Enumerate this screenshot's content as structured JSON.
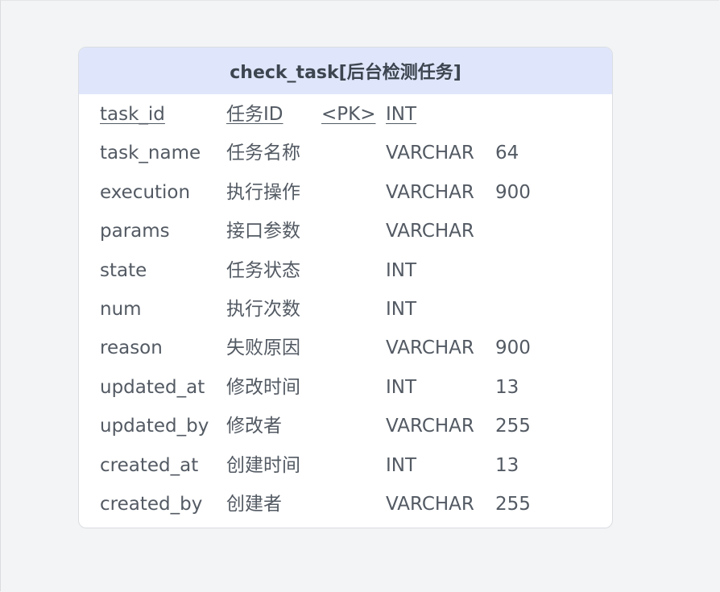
{
  "table": {
    "title": "check_task[后台检测任务]",
    "columns": [
      {
        "field": "task_id",
        "comment": "任务ID",
        "key": "<PK>",
        "type": "INT",
        "length": "",
        "primary": true
      },
      {
        "field": "task_name",
        "comment": "任务名称",
        "key": "",
        "type": "VARCHAR",
        "length": "64",
        "primary": false
      },
      {
        "field": "execution",
        "comment": "执行操作",
        "key": "",
        "type": "VARCHAR",
        "length": "900",
        "primary": false
      },
      {
        "field": "params",
        "comment": "接口参数",
        "key": "",
        "type": "VARCHAR",
        "length": "",
        "primary": false
      },
      {
        "field": "state",
        "comment": "任务状态",
        "key": "",
        "type": "INT",
        "length": "",
        "primary": false
      },
      {
        "field": "num",
        "comment": "执行次数",
        "key": "",
        "type": "INT",
        "length": "",
        "primary": false
      },
      {
        "field": "reason",
        "comment": "失败原因",
        "key": "",
        "type": "VARCHAR",
        "length": "900",
        "primary": false
      },
      {
        "field": "updated_at",
        "comment": "修改时间",
        "key": "",
        "type": "INT",
        "length": "13",
        "primary": false
      },
      {
        "field": "updated_by",
        "comment": "修改者",
        "key": "",
        "type": "VARCHAR",
        "length": "255",
        "primary": false
      },
      {
        "field": "created_at",
        "comment": "创建时间",
        "key": "",
        "type": "INT",
        "length": "13",
        "primary": false
      },
      {
        "field": "created_by",
        "comment": "创建者",
        "key": "",
        "type": "VARCHAR",
        "length": "255",
        "primary": false
      }
    ]
  }
}
